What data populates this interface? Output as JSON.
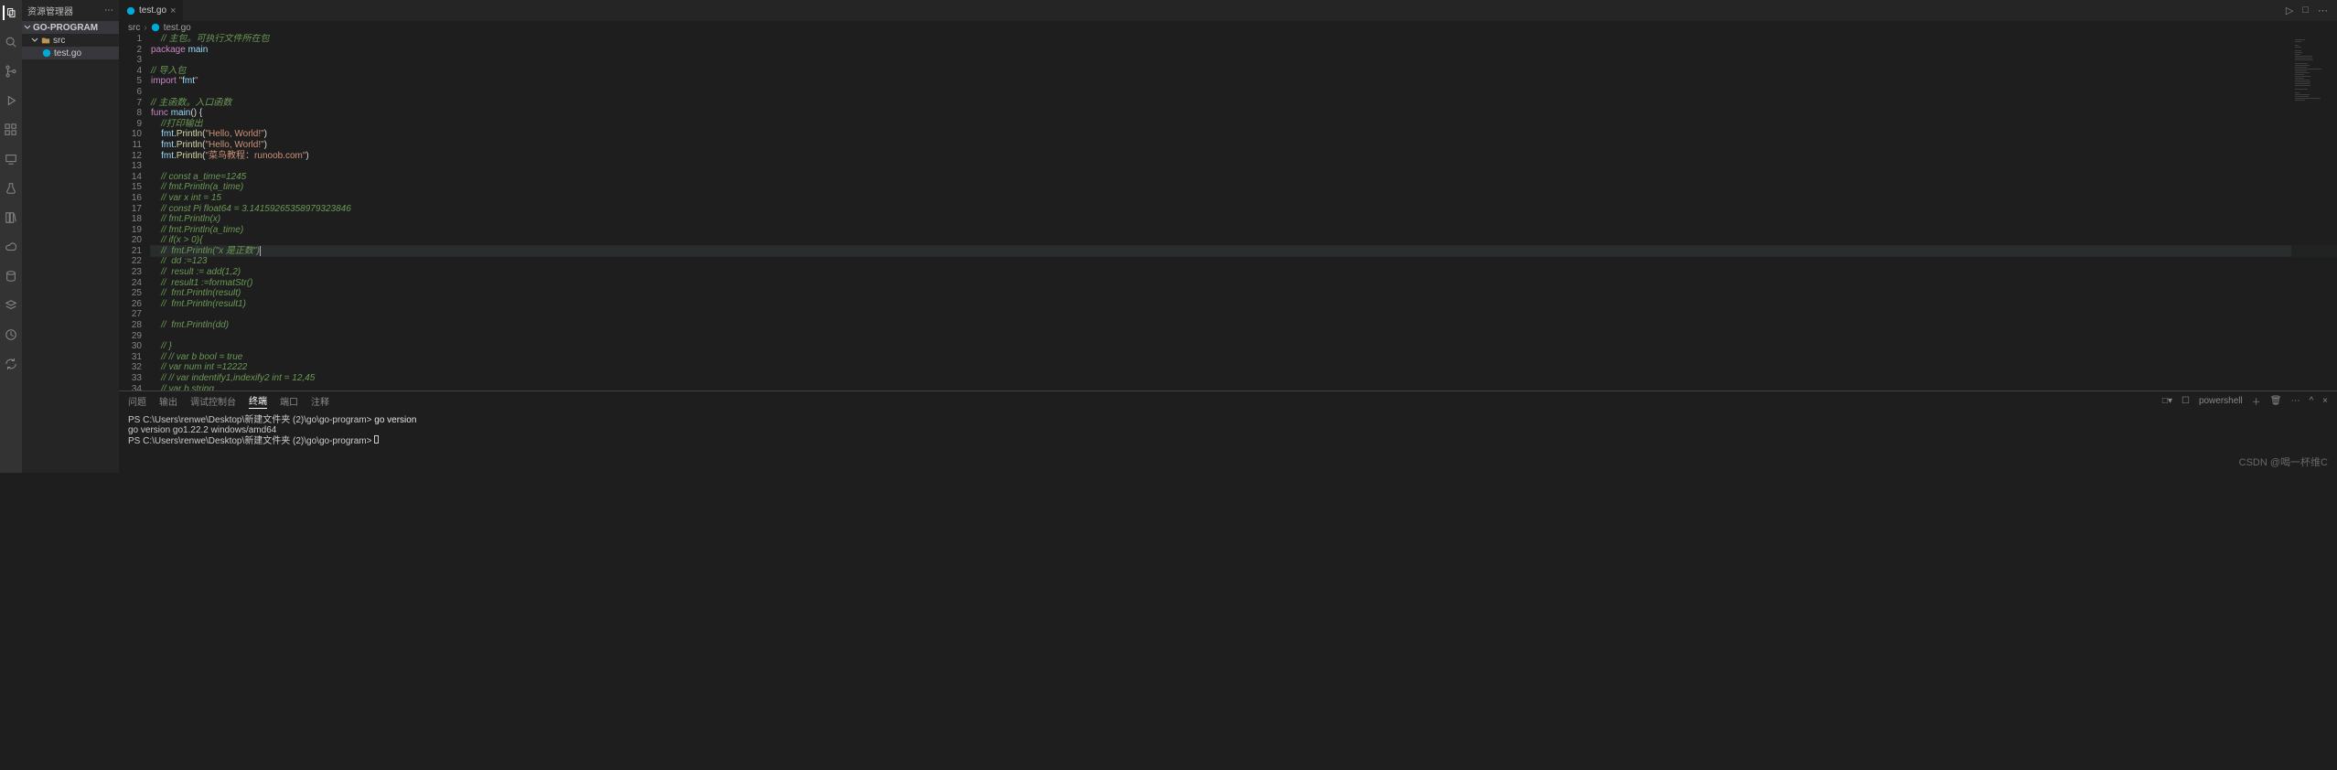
{
  "sidebar": {
    "title": "资源管理器",
    "project": "GO-PROGRAM",
    "tree": [
      {
        "label": "src",
        "kind": "folder"
      },
      {
        "label": "test.go",
        "kind": "go"
      }
    ]
  },
  "tab": {
    "label": "test.go"
  },
  "tab_actions": {
    "run": "▷",
    "split": "□",
    "more": "⋯"
  },
  "breadcrumb": {
    "p0": "src",
    "p1": "test.go"
  },
  "code_lines": [
    "    // 主包。可执行文件所在包",
    "package main",
    "",
    "// 导入包",
    "import \"fmt\"",
    "",
    "// 主函数。入口函数",
    "func main() {",
    "    //打印输出",
    "    fmt.Println(\"Hello, World!\")",
    "    fmt.Println(\"Hello, World!\")",
    "    fmt.Println(\"菜鸟教程：runoob.com\")",
    "",
    "    // const a_time=1245",
    "    // fmt.Println(a_time)",
    "    // var x int = 15",
    "    // const Pi float64 = 3.14159265358979323846",
    "    // fmt.Println(x)",
    "    // fmt.Println(a_time)",
    "    // if(x > 0){",
    "    //  fmt.Println(\"x 是正数\")",
    "    //  dd :=123",
    "    //  result := add(1,2)",
    "    //  result1 :=formatStr()",
    "    //  fmt.Println(result)",
    "    //  fmt.Println(result1)",
    "",
    "    //  fmt.Println(dd)",
    "",
    "    // }",
    "    // // var b bool = true",
    "    // var num int =12222",
    "    // // var indentify1,indexify2 int = 12,45",
    "    // var b string"
  ],
  "panel": {
    "tabs": {
      "t0": "问题",
      "t1": "输出",
      "t2": "调试控制台",
      "t3": "终端",
      "t4": "端口",
      "t5": "注释"
    },
    "shell_label": "powershell",
    "term_lines": [
      "PS C:\\Users\\renwe\\Desktop\\新建文件夹 (2)\\go\\go-program> go version",
      "go version go1.22.2 windows/amd64",
      "PS C:\\Users\\renwe\\Desktop\\新建文件夹 (2)\\go\\go-program> "
    ]
  },
  "watermark": "CSDN @喝一杯维C"
}
